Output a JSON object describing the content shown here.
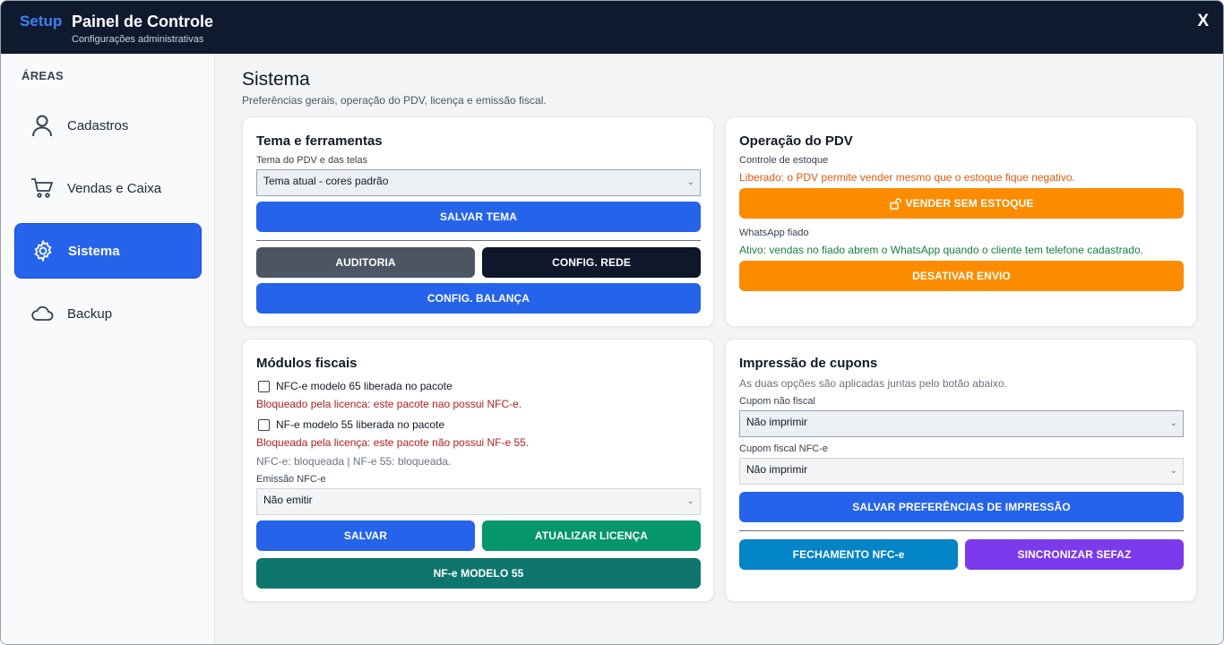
{
  "header": {
    "brand": "Setup",
    "title": "Painel de Controle",
    "subtitle": "Configurações administrativas",
    "close_label": "X"
  },
  "sidebar": {
    "section_label": "ÁREAS",
    "items": [
      {
        "label": "Cadastros",
        "icon": "user-icon"
      },
      {
        "label": "Vendas e Caixa",
        "icon": "cart-icon"
      },
      {
        "label": "Sistema",
        "icon": "gear-icon",
        "active": true
      },
      {
        "label": "Backup",
        "icon": "cloud-icon"
      }
    ]
  },
  "main": {
    "title": "Sistema",
    "subtitle": "Preferências gerais, operação do PDV, licença e emissão fiscal."
  },
  "tema": {
    "title": "Tema e ferramentas",
    "theme_label": "Tema do PDV e das telas",
    "theme_value": "Tema atual - cores padrão",
    "save_theme": "SALVAR TEMA",
    "audit": "AUDITORIA",
    "network": "CONFIG. REDE",
    "scale": "CONFIG. BALANÇA"
  },
  "pdv": {
    "title": "Operação do PDV",
    "stock_label": "Controle de estoque",
    "stock_status": "Liberado: o PDV permite vender mesmo que o estoque fique negativo.",
    "sell_without_stock": "VENDER SEM ESTOQUE",
    "whatsapp_label": "WhatsApp fiado",
    "whatsapp_status": "Ativo: vendas no fiado abrem o WhatsApp quando o cliente tem telefone cadastrado.",
    "disable_send": "DESATIVAR ENVIO"
  },
  "fiscal": {
    "title": "Módulos fiscais",
    "nfce_check": "NFC-e modelo 65 liberada no pacote",
    "nfce_blocked": "Bloqueado pela licenca: este pacote nao possui NFC-e.",
    "nfe_check": "NF-e modelo 55 liberada no pacote",
    "nfe_blocked": "Bloqueada pela licença: este pacote não possui NF-e 55.",
    "summary": "NFC-e: bloqueada | NF-e 55: bloqueada.",
    "emission_label": "Emissão NFC-e",
    "emission_value": "Não emitir",
    "save": "SALVAR",
    "update_license": "ATUALIZAR LICENÇA",
    "nfe_model": "NF-e MODELO 55"
  },
  "print": {
    "title": "Impressão de cupons",
    "note": "As duas opções são aplicadas juntas pelo botão abaixo.",
    "non_fiscal_label": "Cupom não fiscal",
    "non_fiscal_value": "Não imprimir",
    "fiscal_label": "Cupom fiscal NFC-e",
    "fiscal_value": "Não imprimir",
    "save_prefs": "SALVAR PREFERÊNCIAS DE IMPRESSÃO",
    "closing": "FECHAMENTO NFC-e",
    "sync": "SINCRONIZAR SEFAZ"
  },
  "colors": {
    "header_bg": "#0f1a2e",
    "accent_blue": "#2563eb",
    "orange": "#fb8c00",
    "green": "#059669",
    "teal": "#0f766e",
    "purple": "#7c3aed",
    "sky": "#0284c7"
  }
}
